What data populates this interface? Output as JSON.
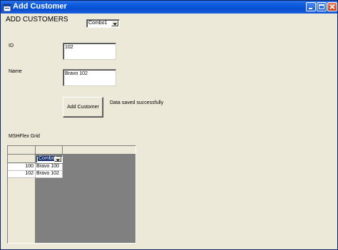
{
  "window": {
    "title": "Add Customer"
  },
  "form": {
    "heading": "ADD CUSTOMERS",
    "combo_value": "Combo1",
    "id_label": "ID",
    "id_value": "102",
    "name_label": "Name",
    "name_value": "Bravo 102",
    "add_button_label": "Add Customer",
    "status_message": "Data saved successfully",
    "grid_label": "MSHFlex Grid"
  },
  "grid": {
    "header_combo_value": "Combo1",
    "rows": [
      {
        "id": "100",
        "name": "Bravo 100"
      },
      {
        "id": "102",
        "name": "Bravo 102"
      }
    ]
  },
  "icons": {
    "app": "vb-form-icon",
    "minimize": "minimize-icon",
    "maximize": "maximize-icon",
    "close": "close-icon",
    "dropdown": "chevron-down-icon"
  }
}
